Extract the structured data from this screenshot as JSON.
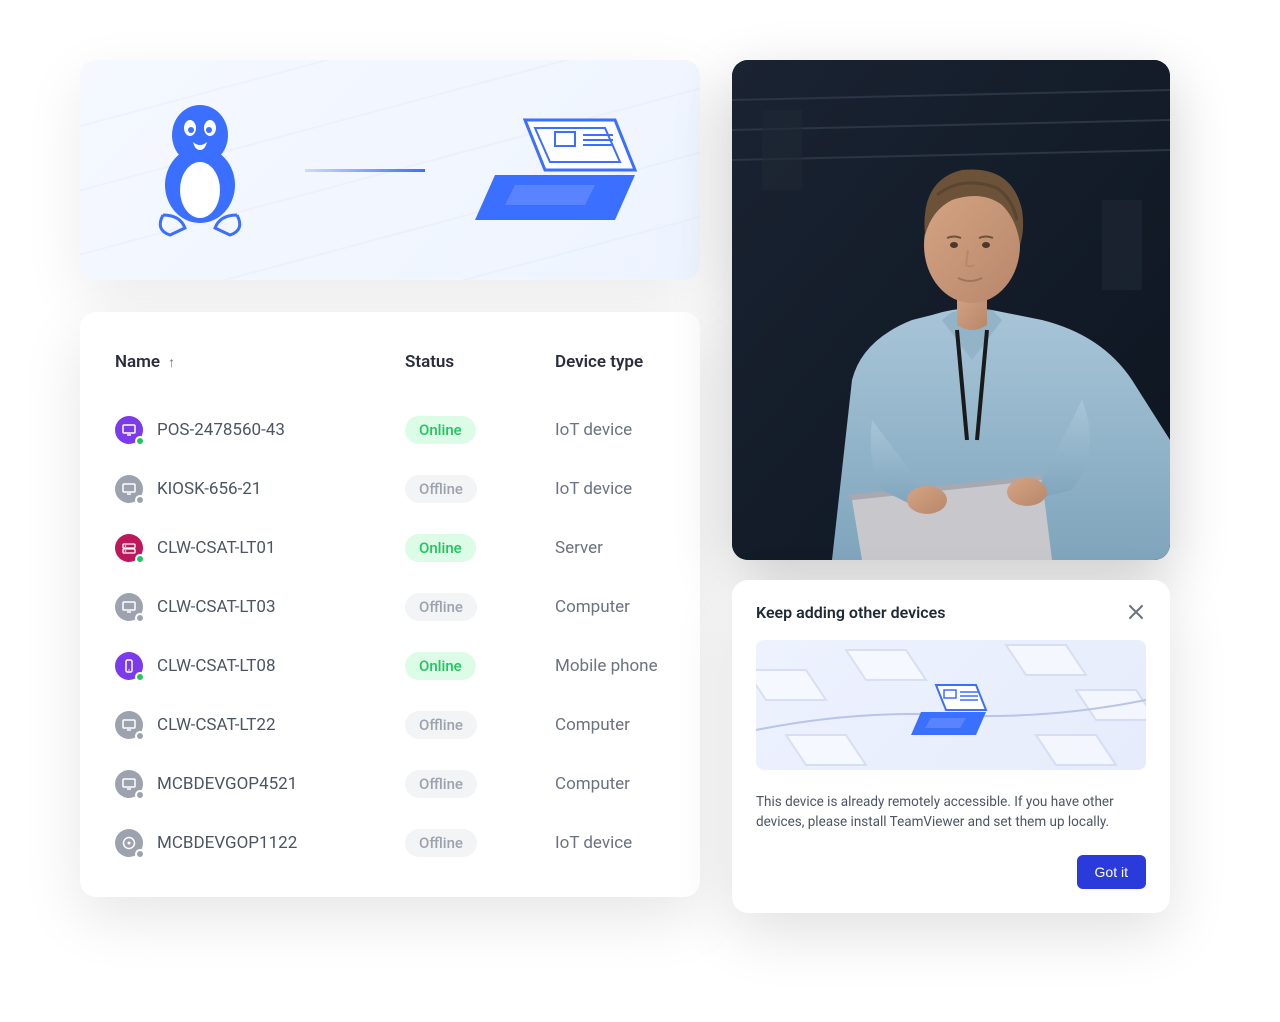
{
  "table": {
    "headers": {
      "name": "Name",
      "status": "Status",
      "type": "Device type"
    },
    "rows": [
      {
        "name": "POS-2478560-43",
        "status": "Online",
        "type": "IoT device",
        "iconColor": "purple",
        "iconKind": "monitor"
      },
      {
        "name": "KIOSK-656-21",
        "status": "Offline",
        "type": "IoT device",
        "iconColor": "gray",
        "iconKind": "monitor"
      },
      {
        "name": "CLW-CSAT-LT01",
        "status": "Online",
        "type": "Server",
        "iconColor": "red",
        "iconKind": "server"
      },
      {
        "name": "CLW-CSAT-LT03",
        "status": "Offline",
        "type": "Computer",
        "iconColor": "gray",
        "iconKind": "monitor"
      },
      {
        "name": "CLW-CSAT-LT08",
        "status": "Online",
        "type": "Mobile phone",
        "iconColor": "purple",
        "iconKind": "phone"
      },
      {
        "name": "CLW-CSAT-LT22",
        "status": "Offline",
        "type": "Computer",
        "iconColor": "gray",
        "iconKind": "monitor"
      },
      {
        "name": "MCBDEVGOP4521",
        "status": "Offline",
        "type": "Computer",
        "iconColor": "gray",
        "iconKind": "monitor"
      },
      {
        "name": "MCBDEVGOP1122",
        "status": "Offline",
        "type": "IoT device",
        "iconColor": "gray",
        "iconKind": "disc"
      }
    ]
  },
  "dialog": {
    "title": "Keep adding other devices",
    "body": "This device is already remotely accessible. If you have other devices, please install TeamViewer and set them up locally.",
    "button": "Got it"
  }
}
